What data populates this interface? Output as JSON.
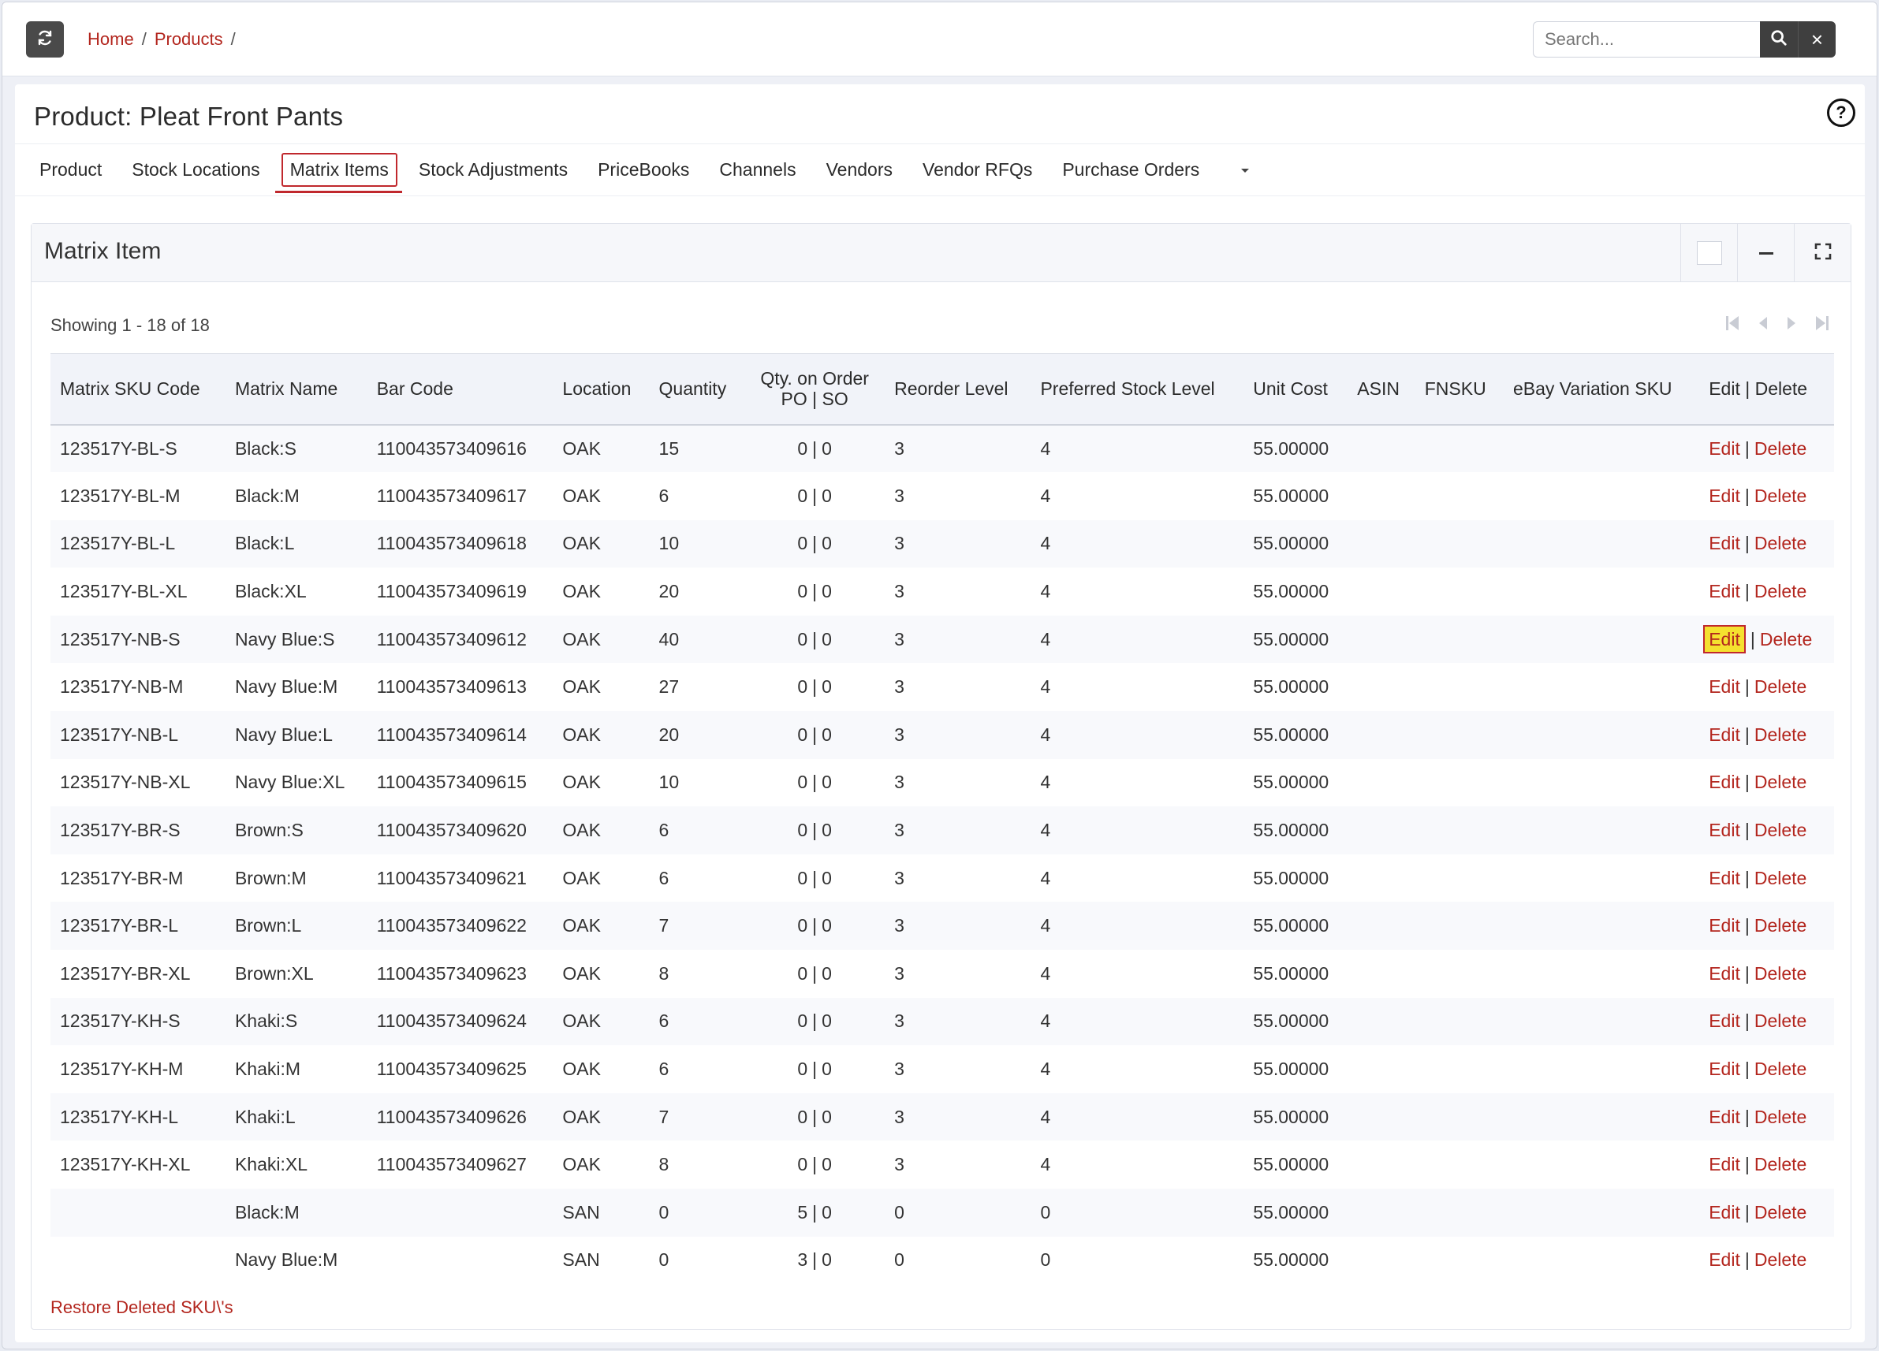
{
  "breadcrumb": {
    "home": "Home",
    "products": "Products",
    "separator": "/"
  },
  "search": {
    "placeholder": "Search...",
    "clear_label": "×"
  },
  "page": {
    "title": "Product: Pleat Front Pants",
    "help_label": "?"
  },
  "tabs": [
    {
      "label": "Product",
      "active": false
    },
    {
      "label": "Stock Locations",
      "active": false
    },
    {
      "label": "Matrix Items",
      "active": true
    },
    {
      "label": "Stock Adjustments",
      "active": false
    },
    {
      "label": "PriceBooks",
      "active": false
    },
    {
      "label": "Channels",
      "active": false
    },
    {
      "label": "Vendors",
      "active": false
    },
    {
      "label": "Vendor RFQs",
      "active": false
    },
    {
      "label": "Purchase Orders",
      "active": false
    }
  ],
  "panel": {
    "title": "Matrix Item",
    "showing": "Showing 1 - 18 of 18"
  },
  "table": {
    "headers": {
      "sku": "Matrix SKU Code",
      "name": "Matrix Name",
      "barcode": "Bar Code",
      "location": "Location",
      "quantity": "Quantity",
      "qty_order_line1": "Qty. on Order",
      "qty_order_line2": "PO | SO",
      "reorder": "Reorder Level",
      "preferred": "Preferred Stock Level",
      "unit_cost": "Unit Cost",
      "asin": "ASIN",
      "fnsku": "FNSKU",
      "ebay": "eBay Variation SKU",
      "actions": "Edit | Delete"
    },
    "edit_label": "Edit",
    "delete_label": "Delete",
    "rows": [
      {
        "sku": "123517Y-BL-S",
        "name": "Black:S",
        "barcode": "110043573409616",
        "location": "OAK",
        "quantity": "15",
        "po": "0",
        "so": "0",
        "reorder": "3",
        "preferred": "4",
        "unit_cost": "55.00000",
        "asin": "",
        "fnsku": "",
        "ebay": ""
      },
      {
        "sku": "123517Y-BL-M",
        "name": "Black:M",
        "barcode": "110043573409617",
        "location": "OAK",
        "quantity": "6",
        "po": "0",
        "so": "0",
        "reorder": "3",
        "preferred": "4",
        "unit_cost": "55.00000",
        "asin": "",
        "fnsku": "",
        "ebay": ""
      },
      {
        "sku": "123517Y-BL-L",
        "name": "Black:L",
        "barcode": "110043573409618",
        "location": "OAK",
        "quantity": "10",
        "po": "0",
        "so": "0",
        "reorder": "3",
        "preferred": "4",
        "unit_cost": "55.00000",
        "asin": "",
        "fnsku": "",
        "ebay": ""
      },
      {
        "sku": "123517Y-BL-XL",
        "name": "Black:XL",
        "barcode": "110043573409619",
        "location": "OAK",
        "quantity": "20",
        "po": "0",
        "so": "0",
        "reorder": "3",
        "preferred": "4",
        "unit_cost": "55.00000",
        "asin": "",
        "fnsku": "",
        "ebay": ""
      },
      {
        "sku": "123517Y-NB-S",
        "name": "Navy Blue:S",
        "barcode": "110043573409612",
        "location": "OAK",
        "quantity": "40",
        "po": "0",
        "so": "0",
        "reorder": "3",
        "preferred": "4",
        "unit_cost": "55.00000",
        "asin": "",
        "fnsku": "",
        "ebay": "",
        "highlight_edit": true
      },
      {
        "sku": "123517Y-NB-M",
        "name": "Navy Blue:M",
        "barcode": "110043573409613",
        "location": "OAK",
        "quantity": "27",
        "po": "0",
        "so": "0",
        "reorder": "3",
        "preferred": "4",
        "unit_cost": "55.00000",
        "asin": "",
        "fnsku": "",
        "ebay": ""
      },
      {
        "sku": "123517Y-NB-L",
        "name": "Navy Blue:L",
        "barcode": "110043573409614",
        "location": "OAK",
        "quantity": "20",
        "po": "0",
        "so": "0",
        "reorder": "3",
        "preferred": "4",
        "unit_cost": "55.00000",
        "asin": "",
        "fnsku": "",
        "ebay": ""
      },
      {
        "sku": "123517Y-NB-XL",
        "name": "Navy Blue:XL",
        "barcode": "110043573409615",
        "location": "OAK",
        "quantity": "10",
        "po": "0",
        "so": "0",
        "reorder": "3",
        "preferred": "4",
        "unit_cost": "55.00000",
        "asin": "",
        "fnsku": "",
        "ebay": ""
      },
      {
        "sku": "123517Y-BR-S",
        "name": "Brown:S",
        "barcode": "110043573409620",
        "location": "OAK",
        "quantity": "6",
        "po": "0",
        "so": "0",
        "reorder": "3",
        "preferred": "4",
        "unit_cost": "55.00000",
        "asin": "",
        "fnsku": "",
        "ebay": ""
      },
      {
        "sku": "123517Y-BR-M",
        "name": "Brown:M",
        "barcode": "110043573409621",
        "location": "OAK",
        "quantity": "6",
        "po": "0",
        "so": "0",
        "reorder": "3",
        "preferred": "4",
        "unit_cost": "55.00000",
        "asin": "",
        "fnsku": "",
        "ebay": ""
      },
      {
        "sku": "123517Y-BR-L",
        "name": "Brown:L",
        "barcode": "110043573409622",
        "location": "OAK",
        "quantity": "7",
        "po": "0",
        "so": "0",
        "reorder": "3",
        "preferred": "4",
        "unit_cost": "55.00000",
        "asin": "",
        "fnsku": "",
        "ebay": ""
      },
      {
        "sku": "123517Y-BR-XL",
        "name": "Brown:XL",
        "barcode": "110043573409623",
        "location": "OAK",
        "quantity": "8",
        "po": "0",
        "so": "0",
        "reorder": "3",
        "preferred": "4",
        "unit_cost": "55.00000",
        "asin": "",
        "fnsku": "",
        "ebay": ""
      },
      {
        "sku": "123517Y-KH-S",
        "name": "Khaki:S",
        "barcode": "110043573409624",
        "location": "OAK",
        "quantity": "6",
        "po": "0",
        "so": "0",
        "reorder": "3",
        "preferred": "4",
        "unit_cost": "55.00000",
        "asin": "",
        "fnsku": "",
        "ebay": ""
      },
      {
        "sku": "123517Y-KH-M",
        "name": "Khaki:M",
        "barcode": "110043573409625",
        "location": "OAK",
        "quantity": "6",
        "po": "0",
        "so": "0",
        "reorder": "3",
        "preferred": "4",
        "unit_cost": "55.00000",
        "asin": "",
        "fnsku": "",
        "ebay": ""
      },
      {
        "sku": "123517Y-KH-L",
        "name": "Khaki:L",
        "barcode": "110043573409626",
        "location": "OAK",
        "quantity": "7",
        "po": "0",
        "so": "0",
        "reorder": "3",
        "preferred": "4",
        "unit_cost": "55.00000",
        "asin": "",
        "fnsku": "",
        "ebay": ""
      },
      {
        "sku": "123517Y-KH-XL",
        "name": "Khaki:XL",
        "barcode": "110043573409627",
        "location": "OAK",
        "quantity": "8",
        "po": "0",
        "so": "0",
        "reorder": "3",
        "preferred": "4",
        "unit_cost": "55.00000",
        "asin": "",
        "fnsku": "",
        "ebay": ""
      },
      {
        "sku": "",
        "name": "Black:M",
        "barcode": "",
        "location": "SAN",
        "quantity": "0",
        "po": "5",
        "so": "0",
        "reorder": "0",
        "preferred": "0",
        "unit_cost": "55.00000",
        "asin": "",
        "fnsku": "",
        "ebay": ""
      },
      {
        "sku": "",
        "name": "Navy Blue:M",
        "barcode": "",
        "location": "SAN",
        "quantity": "0",
        "po": "3",
        "so": "0",
        "reorder": "0",
        "preferred": "0",
        "unit_cost": "55.00000",
        "asin": "",
        "fnsku": "",
        "ebay": ""
      }
    ]
  },
  "footer": {
    "restore_link": "Restore Deleted SKU\\'s"
  },
  "colors": {
    "accent": "#b3261e",
    "active_tab_border": "#c0282d",
    "highlight": "#f5e12f"
  },
  "icons": [
    "refresh-icon",
    "search-icon",
    "close-icon",
    "help-icon",
    "chevron-down-icon",
    "first-page-icon",
    "prev-page-icon",
    "next-page-icon",
    "last-page-icon",
    "expand-icon",
    "minimize-icon"
  ]
}
